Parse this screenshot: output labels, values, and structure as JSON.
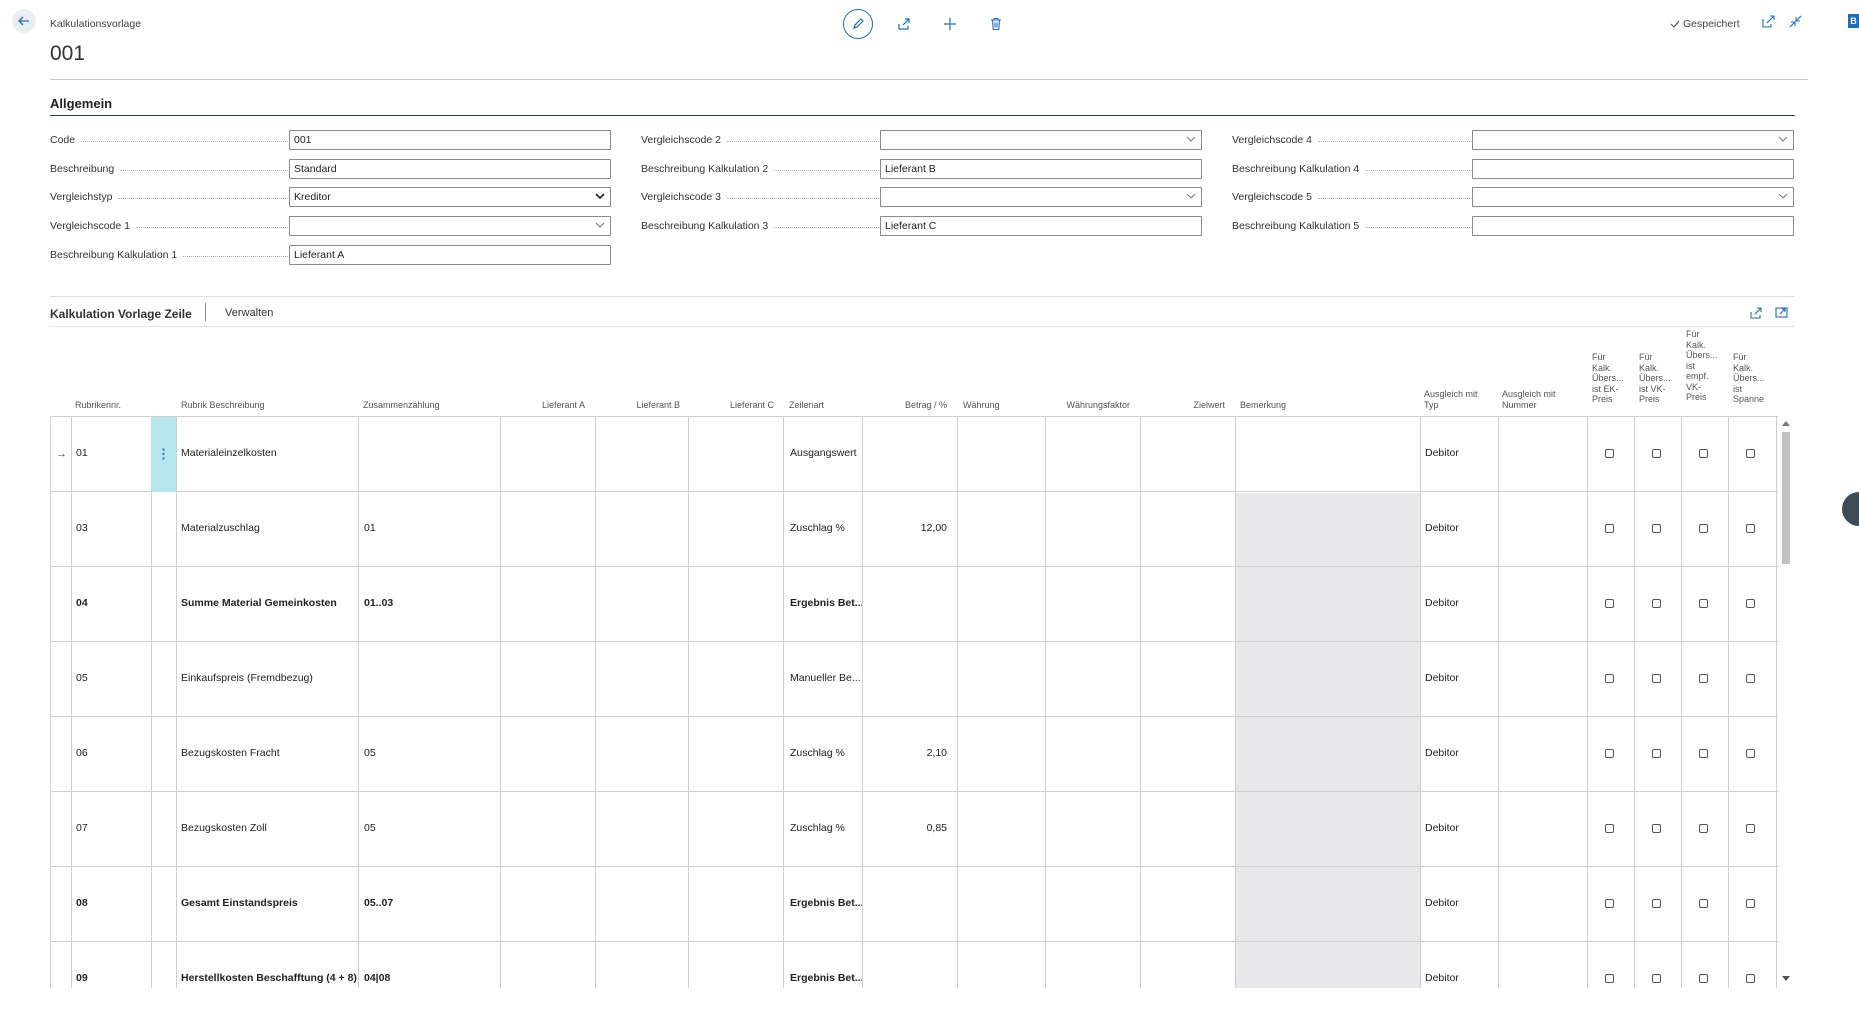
{
  "header": {
    "breadcrumb": "Kalkulationsvorlage",
    "title": "001",
    "saved_label": "Gespeichert",
    "corner_badge": "B"
  },
  "general": {
    "section_title": "Allgemein",
    "col1": [
      {
        "label": "Code",
        "value": "001",
        "type": "text"
      },
      {
        "label": "Beschreibung",
        "value": "Standard",
        "type": "text"
      },
      {
        "label": "Vergleichstyp",
        "value": "Kreditor",
        "type": "select-strong"
      },
      {
        "label": "Vergleichscode 1",
        "value": "",
        "type": "select"
      },
      {
        "label": "Beschreibung Kalkulation 1",
        "value": "Lieferant A",
        "type": "text"
      }
    ],
    "col2": [
      {
        "label": "Vergleichscode 2",
        "value": "",
        "type": "select"
      },
      {
        "label": "Beschreibung Kalkulation 2",
        "value": "Lieferant B",
        "type": "text"
      },
      {
        "label": "Vergleichscode 3",
        "value": "",
        "type": "select"
      },
      {
        "label": "Beschreibung Kalkulation 3",
        "value": "Lieferant C",
        "type": "text"
      }
    ],
    "col3": [
      {
        "label": "Vergleichscode 4",
        "value": "",
        "type": "select"
      },
      {
        "label": "Beschreibung Kalkulation 4",
        "value": "",
        "type": "text"
      },
      {
        "label": "Vergleichscode 5",
        "value": "",
        "type": "select"
      },
      {
        "label": "Beschreibung Kalkulation 5",
        "value": "",
        "type": "text"
      }
    ]
  },
  "lines": {
    "title": "Kalkulation Vorlage Zeile",
    "action": "Verwalten",
    "columns": {
      "rubrik": "Rubrikennr.",
      "beschreibung": "Rubrik Beschreibung",
      "zusammen": "Zusammenzählung",
      "liefA": "Lieferant A",
      "liefB": "Lieferant B",
      "liefC": "Lieferant C",
      "zeilenart": "Zeilenart",
      "betrag": "Betrag / %",
      "waehrung": "Währung",
      "faktor": "Währungsfaktor",
      "zielwert": "Zielwert",
      "bemerkung": "Bemerkung",
      "ausgl_typ": [
        "Ausgleich mit",
        "Typ"
      ],
      "ausgl_nr": [
        "Ausgleich mit",
        "Nummer"
      ],
      "ek": [
        "Für",
        "Kalk.",
        "Übers...",
        "ist EK-",
        "Preis"
      ],
      "vk": [
        "Für",
        "Kalk.",
        "Übers...",
        "ist VK-",
        "Preis"
      ],
      "empf": [
        "Für",
        "Kalk.",
        "Übers...",
        "ist",
        "empf.",
        "VK-",
        "Preis"
      ],
      "spanne": [
        "Für",
        "Kalk.",
        "Übers...",
        "ist",
        "Spanne"
      ]
    },
    "rows": [
      {
        "nr": "01",
        "desc": "Materialeinzelkosten",
        "sum": "",
        "art": "Ausgangswert",
        "betrag": "",
        "typ": "Debitor",
        "bold": false
      },
      {
        "nr": "03",
        "desc": "Materialzuschlag",
        "sum": "01",
        "art": "Zuschlag %",
        "betrag": "12,00",
        "typ": "Debitor",
        "bold": false
      },
      {
        "nr": "04",
        "desc": "Summe Material Gemeinkosten",
        "sum": "01..03",
        "art": "Ergebnis Bet...",
        "betrag": "",
        "typ": "Debitor",
        "bold": true
      },
      {
        "nr": "05",
        "desc": "Einkaufspreis (Fremdbezug)",
        "sum": "",
        "art": "Manueller Be...",
        "betrag": "",
        "typ": "Debitor",
        "bold": false
      },
      {
        "nr": "06",
        "desc": "Bezugskosten Fracht",
        "sum": "05",
        "art": "Zuschlag %",
        "betrag": "2,10",
        "typ": "Debitor",
        "bold": false
      },
      {
        "nr": "07",
        "desc": "Bezugskosten Zoll",
        "sum": "05",
        "art": "Zuschlag %",
        "betrag": "0,85",
        "typ": "Debitor",
        "bold": false
      },
      {
        "nr": "08",
        "desc": "Gesamt Einstandspreis",
        "sum": "05..07",
        "art": "Ergebnis Bet...",
        "betrag": "",
        "typ": "Debitor",
        "bold": true
      },
      {
        "nr": "09",
        "desc": "Herstellkosten Beschafftung (4 + 8)",
        "sum": "04|08",
        "art": "Ergebnis Bet...",
        "betrag": "",
        "typ": "Debitor",
        "bold": true
      }
    ]
  }
}
